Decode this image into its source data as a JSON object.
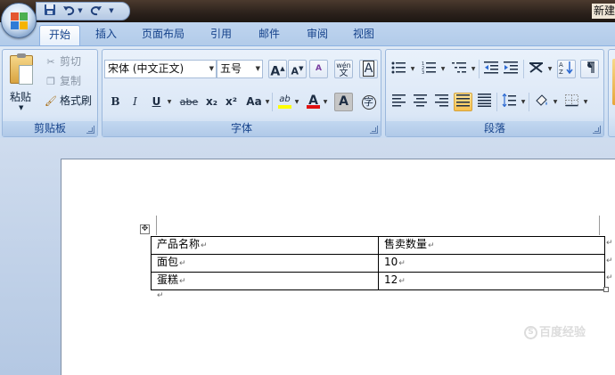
{
  "title_bar": {
    "window_title_fragment": "新建"
  },
  "ribbon_tabs": [
    {
      "label": "开始",
      "active": true
    },
    {
      "label": "插入",
      "active": false
    },
    {
      "label": "页面布局",
      "active": false
    },
    {
      "label": "引用",
      "active": false
    },
    {
      "label": "邮件",
      "active": false
    },
    {
      "label": "审阅",
      "active": false
    },
    {
      "label": "视图",
      "active": false
    }
  ],
  "clipboard": {
    "paste_label": "粘贴",
    "cut_label": "剪切",
    "copy_label": "复制",
    "format_painter_label": "格式刷",
    "group_label": "剪贴板"
  },
  "font_group": {
    "font_name": "宋体 (中文正文)",
    "font_size": "五号",
    "group_label": "字体",
    "grow_glyph": "A",
    "shrink_glyph": "A",
    "bold_glyph": "B",
    "italic_glyph": "I",
    "underline_glyph": "U",
    "strike_glyph": "abe",
    "sub_glyph": "x₂",
    "sup_glyph": "x²",
    "case_glyph": "Aa",
    "phonetic_glyph": "wén",
    "char_border_glyph": "A",
    "font_color_glyph": "A",
    "char_shade_glyph": "A",
    "enclose_glyph": "字",
    "highlight_glyph": "ab",
    "clear_format_glyph": "A"
  },
  "paragraph_group": {
    "group_label": "段落"
  },
  "document_table": {
    "rows": [
      [
        "产品名称",
        "售卖数量"
      ],
      [
        "面包",
        "10"
      ],
      [
        "蛋糕",
        "12"
      ]
    ]
  },
  "watermark": {
    "text": "百度经验",
    "logo_glyph": "S"
  },
  "colors": {
    "ribbon_text": "#15428b",
    "font_color_underline": "#e01010",
    "highlight_underline": "#ffff00"
  }
}
